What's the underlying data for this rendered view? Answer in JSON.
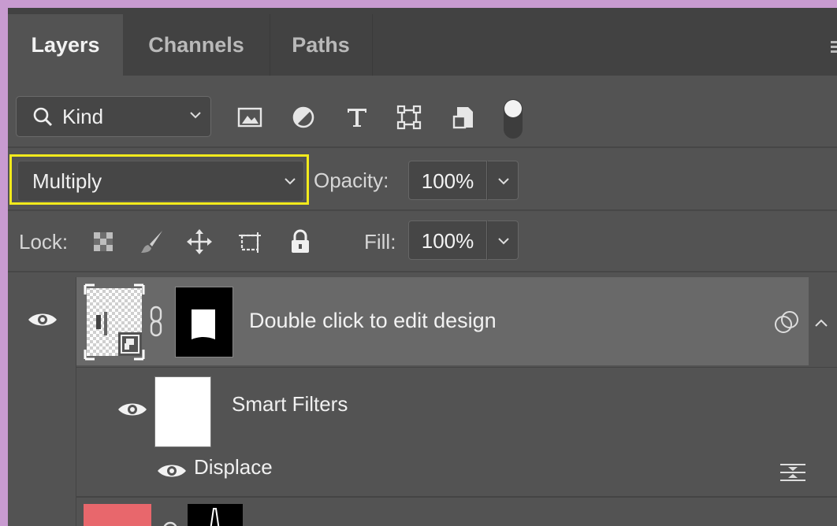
{
  "tabs": [
    {
      "label": "Layers",
      "active": true
    },
    {
      "label": "Channels",
      "active": false
    },
    {
      "label": "Paths",
      "active": false
    }
  ],
  "filter": {
    "kind_label": "Kind",
    "icons": [
      "image-filter-icon",
      "adjustment-filter-icon",
      "type-filter-icon",
      "shape-filter-icon",
      "smart-object-filter-icon",
      "filter-toggle-icon"
    ]
  },
  "blend": {
    "mode": "Multiply",
    "highlight_color": "#f2ea1c",
    "opacity_label": "Opacity:",
    "opacity_value": "100%"
  },
  "lock": {
    "label": "Lock:",
    "icons": [
      "lock-transparent-pixels-icon",
      "lock-image-pixels-icon",
      "lock-position-icon",
      "lock-artboard-icon",
      "lock-all-icon"
    ],
    "fill_label": "Fill:",
    "fill_value": "100%"
  },
  "layers": {
    "main": {
      "name": "Double click to edit design",
      "visible": true,
      "selected": true
    },
    "smart_filters": {
      "name": "Smart Filters",
      "visible": true
    },
    "displace": {
      "name": "Displace",
      "visible": true
    },
    "bottom_layer": {
      "thumb_color": "#e8676c",
      "visible": true
    }
  }
}
